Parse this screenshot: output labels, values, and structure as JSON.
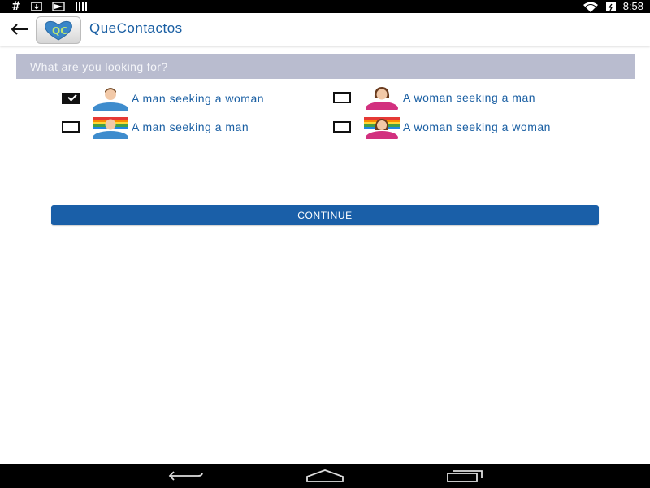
{
  "status_bar": {
    "left_icons": [
      "hash-icon",
      "download-icon",
      "send-icon",
      "signal-icon"
    ],
    "right_icons": [
      "wifi-icon",
      "battery-icon"
    ],
    "time": "8:58"
  },
  "app_bar": {
    "back_icon": "arrow-left-icon",
    "logo_icon": "app-logo-icon",
    "title": "QueContactos"
  },
  "question": {
    "text": "What are you looking for?"
  },
  "options": [
    {
      "label": "A man seeking a woman",
      "checked": true,
      "avatar": "man-avatar-icon"
    },
    {
      "label": "A woman seeking a man",
      "checked": false,
      "avatar": "woman-avatar-icon"
    },
    {
      "label": "A man seeking a man",
      "checked": false,
      "avatar": "man-rainbow-avatar-icon"
    },
    {
      "label": "A woman seeking a woman",
      "checked": false,
      "avatar": "woman-rainbow-avatar-icon"
    }
  ],
  "continue_button": {
    "label": "CONTINUE",
    "color": "#1a5fa8"
  },
  "colors": {
    "accent": "#1a5fa3",
    "banner": "#b9bccf"
  },
  "nav_bar": {
    "icons": [
      "nav-back-icon",
      "nav-home-icon",
      "nav-recents-icon"
    ]
  }
}
